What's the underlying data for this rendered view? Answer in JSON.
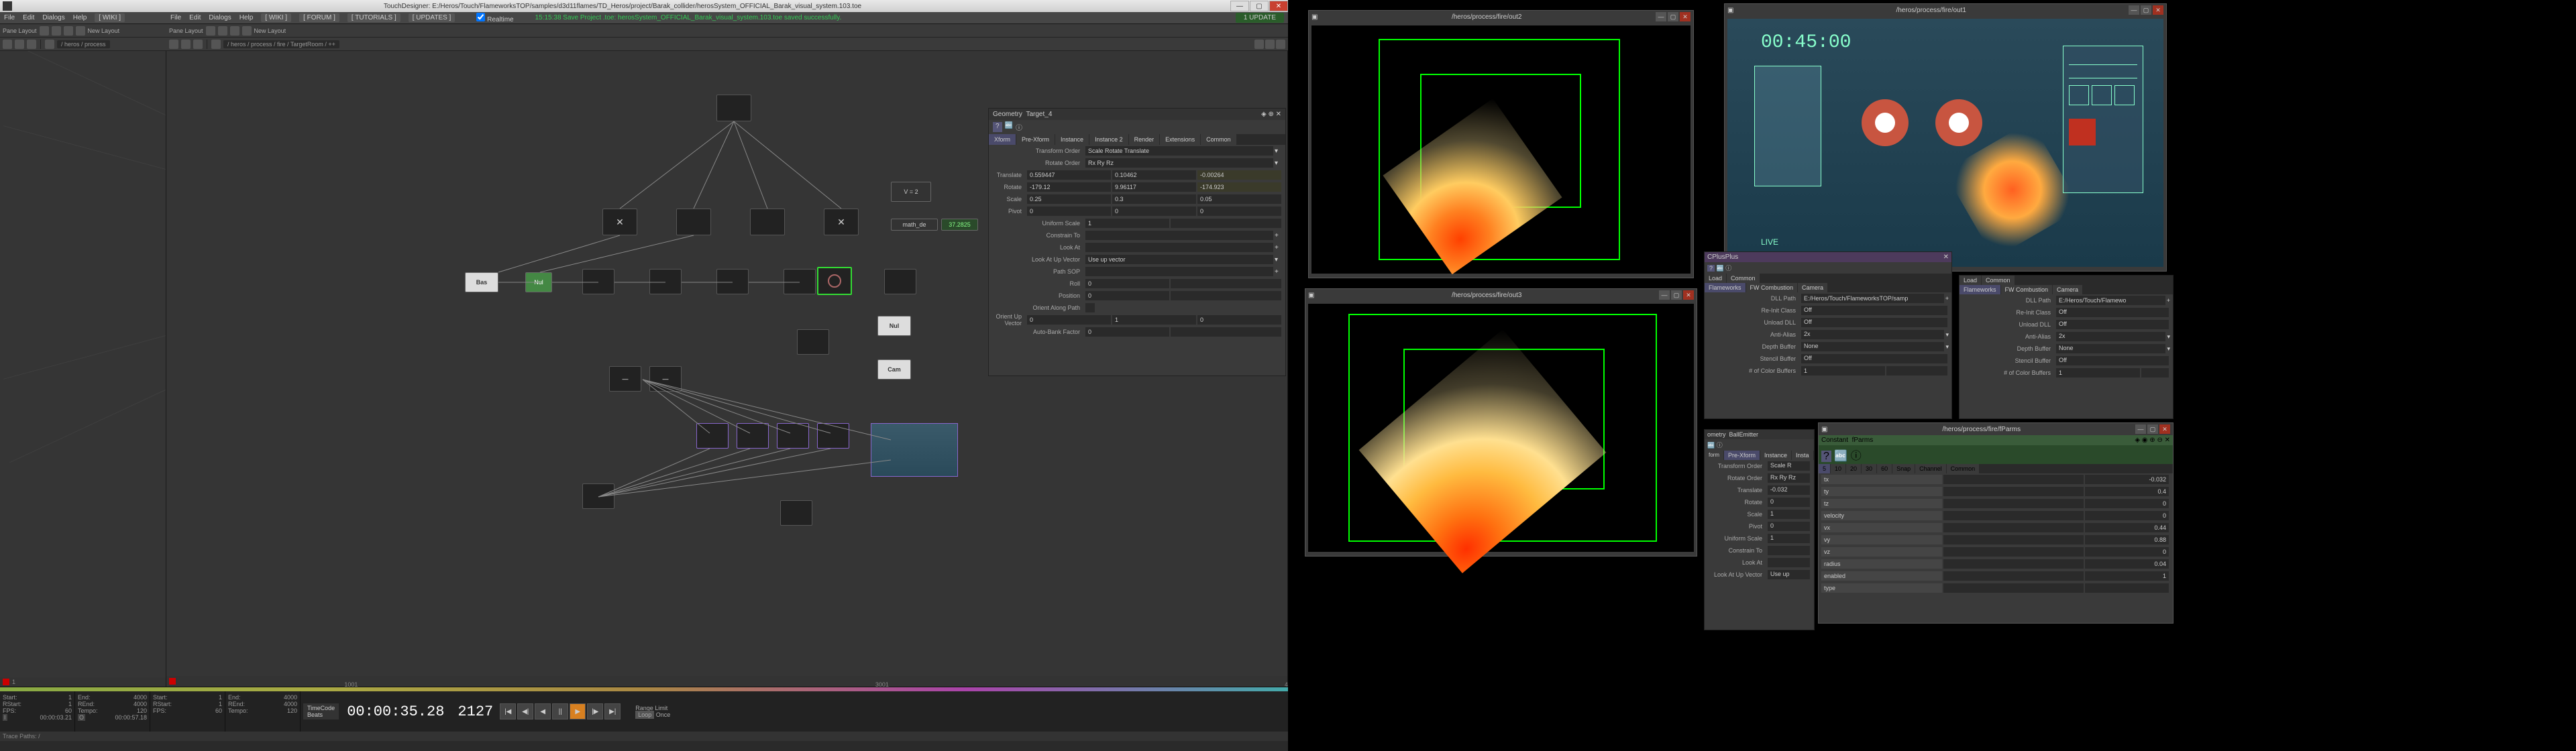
{
  "titlebar": {
    "text": "TouchDesigner: E:/Heros/Touch/FlameworksTOP/samples/d3d11flames/TD_Heros/project/Barak_collider/herosSystem_OFFICIAL_Barak_visual_system.103.toe"
  },
  "menus": {
    "file": "File",
    "edit": "Edit",
    "dialogs": "Dialogs",
    "help": "Help",
    "wiki": "[ WIKI ]",
    "forum": "[ FORUM ]",
    "tutorials": "[ TUTORIALS ]",
    "updates": "[ UPDATES ]",
    "realtime": "Realtime",
    "status": "15:15:38 Save Project .toe: herosSystem_OFFICIAL_Barak_visual_system.103.toe saved successfully."
  },
  "toolbar": {
    "path_left": "/ heros / process",
    "pane_layout": "Pane Layout",
    "new_layout": "New Layout",
    "path_center": "/ heros / process / fire / TargetRoom / ++"
  },
  "nodes": {
    "bas": "Bas",
    "nul1": "Nul",
    "nul2": "Nul",
    "cam": "Cam",
    "v_eq_2": "V = 2",
    "math_de": "math_de",
    "math_val": "37.2825"
  },
  "params": {
    "title_type": "Geometry",
    "title_name": "Target_4",
    "tab_xform": "Xform",
    "tab_prexform": "Pre-Xform",
    "tab_instance": "Instance",
    "tab_instance2": "Instance 2",
    "tab_render": "Render",
    "tab_extensions": "Extensions",
    "tab_common": "Common",
    "transform_order": "Transform Order",
    "transform_order_val": "Scale Rotate Translate",
    "rotate_order": "Rotate Order",
    "rotate_order_val": "Rx Ry Rz",
    "translate": "Translate",
    "translate_x": "0.559447",
    "translate_y": "0.10462",
    "translate_z": "-0.00264",
    "rotate": "Rotate",
    "rotate_x": "-179.12",
    "rotate_y": "9.96117",
    "rotate_z": "-174.923",
    "scale": "Scale",
    "scale_x": "0.25",
    "scale_y": "0.3",
    "scale_z": "0.05",
    "pivot": "Pivot",
    "pivot_x": "0",
    "pivot_y": "0",
    "pivot_z": "0",
    "uniform_scale": "Uniform Scale",
    "uniform_scale_val": "1",
    "constrain_to": "Constrain To",
    "look_at": "Look At",
    "look_at_up_vector": "Look At Up Vector",
    "look_at_up_vector_val": "Use up vector",
    "path_sop": "Path SOP",
    "roll": "Roll",
    "roll_val": "0",
    "position": "Position",
    "position_val": "0",
    "orient_along_path": "Orient Along Path",
    "orient_up_vector": "Orient Up Vector",
    "orient_up_x": "0",
    "orient_up_y": "1",
    "orient_up_z": "0",
    "auto_bank_factor": "Auto-Bank Factor",
    "auto_bank_val": "0"
  },
  "timeline": {
    "path": "Trace Paths: /",
    "timecode_label": "TimeCode",
    "beats_label": "Beats",
    "time": "00:00:35.28",
    "frame": "2127",
    "range_limit": "Range Limit",
    "loop": "Loop",
    "once": "Once",
    "info1": {
      "start": "Start:",
      "start_v": "1",
      "rstart": "RStart:",
      "rstart_v": "1",
      "fps": "FPS:",
      "fps_v": "60",
      "time": "00:00:03.21"
    },
    "info2": {
      "end": "End:",
      "end_v": "4000",
      "rend": "REnd:",
      "rend_v": "4000",
      "tempo": "Tempo:",
      "tempo_v": "120",
      "time": "00:00:57.18"
    },
    "info3": {
      "start": "Start:",
      "start_v": "1",
      "rstart": "RStart:",
      "rstart_v": "1",
      "fps": "FPS:",
      "fps_v": "60"
    },
    "info4": {
      "end": "End:",
      "end_v": "4000",
      "rend": "REnd:",
      "rend_v": "4000",
      "tempo": "Tempo:",
      "tempo_v": "120"
    },
    "ruler_start": "1001",
    "ruler_3001": "3001"
  },
  "viewers": {
    "out2": "/heros/process/fire/out2",
    "out1": "/heros/process/fire/out1",
    "out3": "/heros/process/fire/out3",
    "fparms": "/heros/process/fire/fParms",
    "hud_timer": "00:45:00",
    "hud_live": "LIVE"
  },
  "cplus": {
    "title": "CPlusPlus",
    "tab_load": "Load",
    "tab_common": "Common",
    "tab_flameworks": "Flameworks",
    "tab_combustion": "FW Combustion",
    "tab_camera": "Camera",
    "dll_path": "DLL Path",
    "dll_path_val": "E:/Heros/Touch/FlameworksTOP/samp",
    "reinit_class": "Re-Init Class",
    "reinit_class_val": "Off",
    "unload_dll": "Unload DLL",
    "unload_dll_val": "Off",
    "anti_alias": "Anti-Alias",
    "anti_alias_val": "2x",
    "depth_buffer": "Depth Buffer",
    "depth_buffer_val": "None",
    "stencil_buffer": "Stencil Buffer",
    "stencil_buffer_val": "Off",
    "color_buffers": "# of Color Buffers",
    "color_buffers_val": "1"
  },
  "ballEmitter": {
    "type": "ometry",
    "name": "BallEmitter",
    "tab_prexform": "Pre-Xform",
    "tab_instance": "Instance",
    "tab_inst": "Insta",
    "transform_order": "Transform Order",
    "transform_order_val": "Scale R",
    "rotate_order": "Rotate Order",
    "rotate_order_val": "Rx Ry Rz",
    "translate": "Translate",
    "translate_val": "-0.032",
    "rotate": "Rotate",
    "rotate_val": "0",
    "scale": "Scale",
    "scale_val": "1",
    "pivot": "Pivot",
    "pivot_val": "0",
    "uniform_scale": "Uniform Scale",
    "uniform_scale_val": "1",
    "constrain_to": "Constrain To",
    "look_at": "Look At",
    "look_at_up": "Look At Up Vector",
    "look_at_up_val": "Use up"
  },
  "fparms": {
    "type": "Constant",
    "name": "fParms",
    "tabs": [
      "5",
      "10",
      "20",
      "30",
      "60",
      "Snap",
      "Channel",
      "Common"
    ],
    "channels": [
      {
        "name": "tx",
        "val": "-0.032"
      },
      {
        "name": "ty",
        "val": "0.4"
      },
      {
        "name": "tz",
        "val": "0"
      },
      {
        "name": "velocity",
        "val": "0"
      },
      {
        "name": "vx",
        "val": "0.44"
      },
      {
        "name": "vy",
        "val": "0.88"
      },
      {
        "name": "vz",
        "val": "0"
      },
      {
        "name": "radius",
        "val": "0.04"
      },
      {
        "name": "enabled",
        "val": "1"
      },
      {
        "name": "type",
        "val": ""
      }
    ]
  }
}
